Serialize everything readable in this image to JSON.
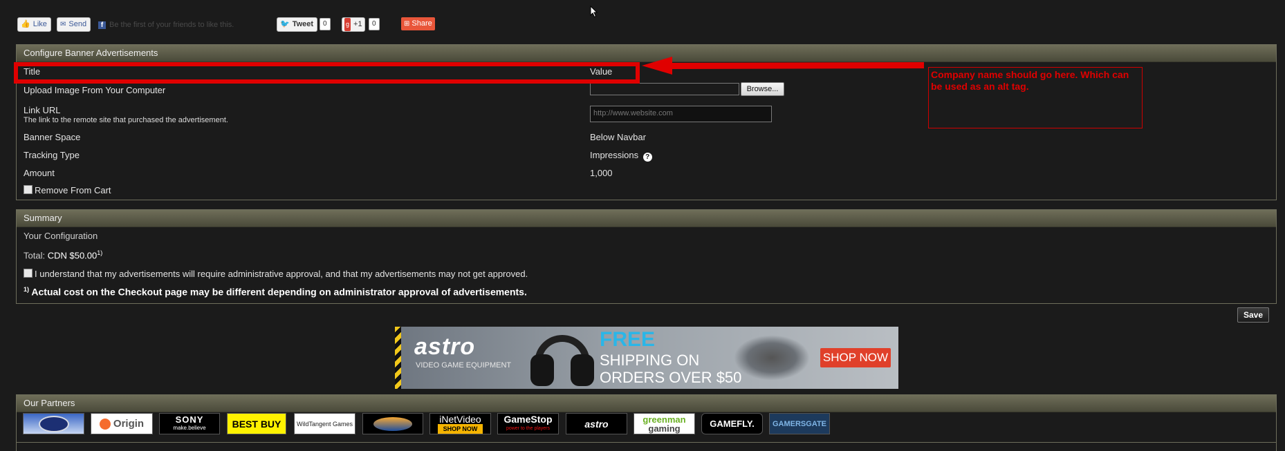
{
  "social": {
    "like": "Like",
    "send": "Send",
    "fb_text": "Be the first of your friends to like this.",
    "tweet": "Tweet",
    "tweet_count": "0",
    "plus_one": "+1",
    "plus_count": "0",
    "share": "Share"
  },
  "config": {
    "header": "Configure Banner Advertisements",
    "col_title": "Title",
    "col_value": "Value",
    "upload_label": "Upload Image From Your Computer",
    "browse": "Browse...",
    "link_label": "Link URL",
    "link_help": "The link to the remote site that purchased the advertisement.",
    "link_placeholder": "http://www.website.com",
    "banner_space_label": "Banner Space",
    "banner_space_value": "Below Navbar",
    "tracking_label": "Tracking Type",
    "tracking_value": "Impressions",
    "amount_label": "Amount",
    "amount_value": "1,000",
    "remove_label": "Remove From Cart"
  },
  "annotation": {
    "note": "Company name should go here. Which can be used as an alt tag."
  },
  "summary": {
    "header": "Summary",
    "your_config": "Your Configuration",
    "total_label": "Total:",
    "total_value": "CDN $50.00",
    "total_sup": "1)",
    "approval_text": "I understand that my advertisements will require administrative approval, and that my advertisements may not get approved.",
    "footnote_sup": "1)",
    "footnote_text": "Actual cost on the Checkout page may be different depending on administrator approval of advertisements."
  },
  "save": "Save",
  "banner": {
    "brand": "astro",
    "tagline": "VIDEO GAME EQUIPMENT",
    "free": "FREE",
    "shipping1": "SHIPPING ON",
    "shipping2": "ORDERS OVER $50",
    "cta": "SHOP NOW"
  },
  "partners": {
    "header": "Our Partners",
    "logos": [
      "Origin",
      "SONY",
      "make.believe",
      "BEST BUY",
      "WildTangent Games",
      "iNetVideo",
      "SHOP NOW",
      "GameStop",
      "power to the players",
      "astro",
      "greenman",
      "gaming",
      "GAMEFLY.",
      "GAMERSGATE"
    ]
  },
  "colors": {
    "annotation_red": "#e00000",
    "panel_header": "#5c5b48",
    "banner_accent": "#e0402a",
    "banner_free": "#2ab6e8"
  }
}
